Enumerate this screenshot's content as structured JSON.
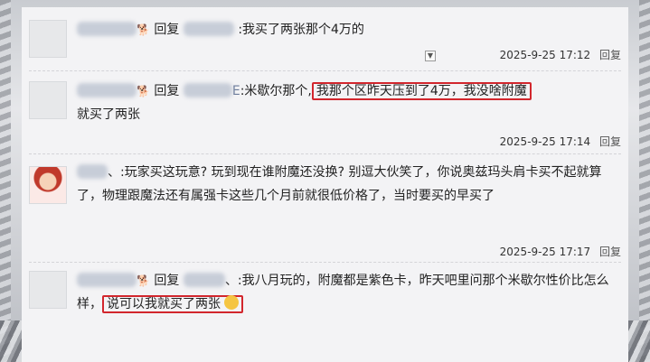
{
  "comments": [
    {
      "reply_word": "回复",
      "text": ":我买了两张那个4万的",
      "timestamp": "2025-9-25 17:12",
      "reply_label": "回复"
    },
    {
      "reply_word": "回复",
      "target_suffix": "E",
      "text_prefix": ":米歇尔那个,",
      "highlight": "我那个区昨天压到了4万，我没啥附魔",
      "text_suffix": "就买了两张",
      "timestamp": "2025-9-25 17:14",
      "reply_label": "回复"
    },
    {
      "name_suffix": "、",
      "text": ":玩家买这玩意? 玩到现在谁附魔还没换? 别逗大伙笑了，你说奥兹玛头肩卡买不起就算了，物理跟魔法还有属强卡这些几个月前就很低价格了，当时要买的早买了",
      "timestamp": "2025-9-25 17:17",
      "reply_label": "回复"
    },
    {
      "reply_word": "回复",
      "target_suffix": "、",
      "text_prefix": ":我八月玩的，附魔都是紫色卡，昨天吧里问那个米歇尔性价比怎么样，",
      "highlight": "说可以我就买了两张",
      "timestamp": "",
      "reply_label": ""
    }
  ],
  "colors": {
    "highlight_border": "#d2262d"
  }
}
